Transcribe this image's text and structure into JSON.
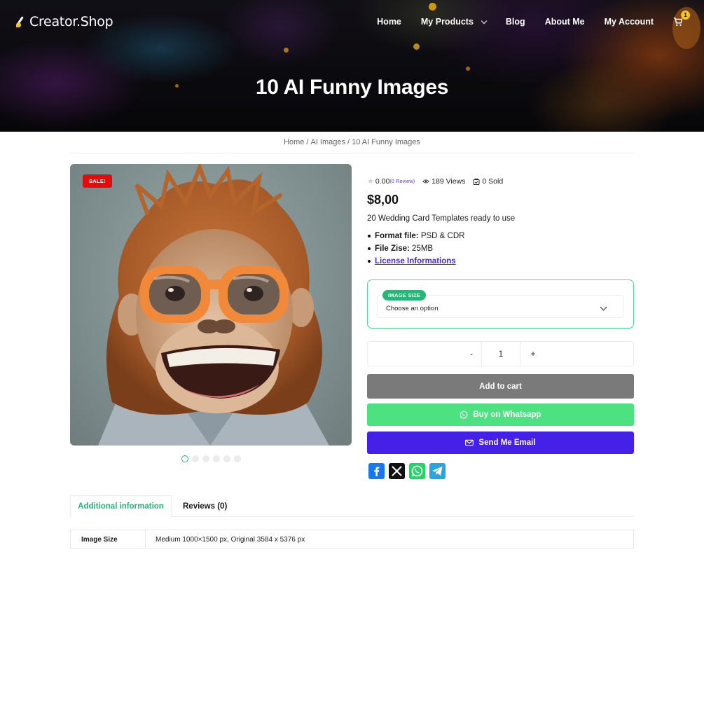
{
  "site": {
    "logo_text": "Creator.Shop",
    "accent_color": "#2bb37a",
    "nav": [
      {
        "label": "Home"
      },
      {
        "label": "My Products"
      },
      {
        "label": "Blog"
      },
      {
        "label": "About Me"
      },
      {
        "label": "My Account"
      }
    ],
    "cart_count": "1"
  },
  "page": {
    "title": "10 AI Funny Images",
    "breadcrumb": [
      "Home",
      "AI Images",
      "10 AI Funny Images"
    ]
  },
  "product": {
    "sale_badge": "SALE!",
    "gallery_dots": 6,
    "gallery_active_index": 0,
    "rating": "0.00",
    "review_link": "(0 Review)",
    "views": "189 Views",
    "sold": "0 Sold",
    "price": "$8,00",
    "description": "20 Wedding Card Templates ready to use",
    "features": [
      {
        "label": "Format file:",
        "value": " PSD & CDR"
      },
      {
        "label": "File Zise:",
        "value": " 25MB"
      }
    ],
    "license_link": "License Informations",
    "variation": {
      "label": "IMAGE SIZE",
      "placeholder": "Choose an option"
    },
    "quantity": {
      "minus": "-",
      "value": "1",
      "plus": "+"
    },
    "buttons": {
      "add_to_cart": "Add to cart",
      "whatsapp": "Buy on Whatsapp",
      "email": "Send Me Email"
    },
    "share": [
      "facebook",
      "x",
      "whatsapp",
      "telegram"
    ]
  },
  "tabs": [
    {
      "label": "Additional information",
      "active": true
    },
    {
      "label": "Reviews (0)",
      "active": false
    }
  ],
  "attributes": [
    {
      "key": "Image Size",
      "value": "Medium 1000×1500 px, Original 3584 x 5376 px"
    }
  ]
}
